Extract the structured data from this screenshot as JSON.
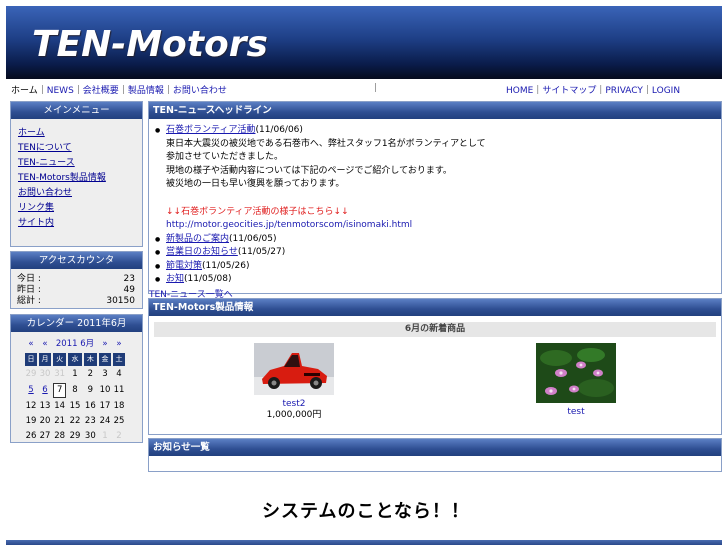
{
  "header": {
    "site_title": "TEN-Motors"
  },
  "nav": {
    "left": [
      "ホーム",
      "NEWS",
      "会社概要",
      "製品情報",
      "お問い合わせ"
    ],
    "mid": "｜",
    "right": [
      "HOME",
      "サイトマップ",
      "PRIVACY",
      "LOGIN"
    ]
  },
  "side_menu": {
    "title": "メインメニュー",
    "items": [
      "ホーム",
      "TENについて",
      "TEN-ニュース",
      "TEN-Motors製品情報",
      "お問い合わせ",
      "リンク集",
      "サイト内"
    ]
  },
  "stats": {
    "title": "アクセスカウンタ",
    "rows": [
      {
        "label": "今日 :",
        "value": "23"
      },
      {
        "label": "昨日 :",
        "value": "49"
      },
      {
        "label": "総計 :",
        "value": "30150"
      }
    ]
  },
  "calendar": {
    "title": "カレンダー 2011年6月",
    "nav": [
      "«",
      "«",
      "2011 6月",
      "»",
      "»"
    ],
    "dow": [
      "日",
      "月",
      "火",
      "水",
      "木",
      "金",
      "土"
    ],
    "weeks": [
      [
        "29",
        "30",
        "31",
        "1",
        "2",
        "3",
        "4"
      ],
      [
        "5",
        "6",
        "7",
        "8",
        "9",
        "10",
        "11"
      ],
      [
        "12",
        "13",
        "14",
        "15",
        "16",
        "17",
        "18"
      ],
      [
        "19",
        "20",
        "21",
        "22",
        "23",
        "24",
        "25"
      ],
      [
        "26",
        "27",
        "28",
        "29",
        "30",
        "1",
        "2"
      ]
    ]
  },
  "news": {
    "title": "TEN-ニュースヘッドライン",
    "first": {
      "headline": "石巻ボランティア活動",
      "date": "(11/06/06)"
    },
    "body": [
      "東日本大震災の被災地である石巻市へ、弊社スタッフ1名がボランティアとして",
      "参加させていただきました。",
      "現地の様子や活動内容については下記のページでご紹介しております。",
      "被災地の一日も早い復興を願っております。"
    ],
    "red_line": "↓↓石巻ボランティア活動の様子はこちら↓↓",
    "url": "http://motor.geocities.jp/tenmotorscom/isinomaki.html",
    "items": [
      {
        "headline": "新製品のご案内",
        "date": "(11/06/05)"
      },
      {
        "headline": "営業日のお知らせ",
        "date": "(11/05/27)"
      },
      {
        "headline": "節電対策",
        "date": "(11/05/26)"
      },
      {
        "headline": "お知",
        "date": "(11/05/08)"
      }
    ],
    "more": "TEN-ニュース一覧へ"
  },
  "products": {
    "title": "TEN-Motors製品情報",
    "bar": "6月の新着商品",
    "items": [
      {
        "name": "test2",
        "price": "1,000,000円"
      },
      {
        "name": "test",
        "price": ""
      }
    ]
  },
  "bottom_panel": {
    "title": "お知らせ一覧"
  },
  "footer": {
    "tagline": "システムのことなら！！"
  }
}
